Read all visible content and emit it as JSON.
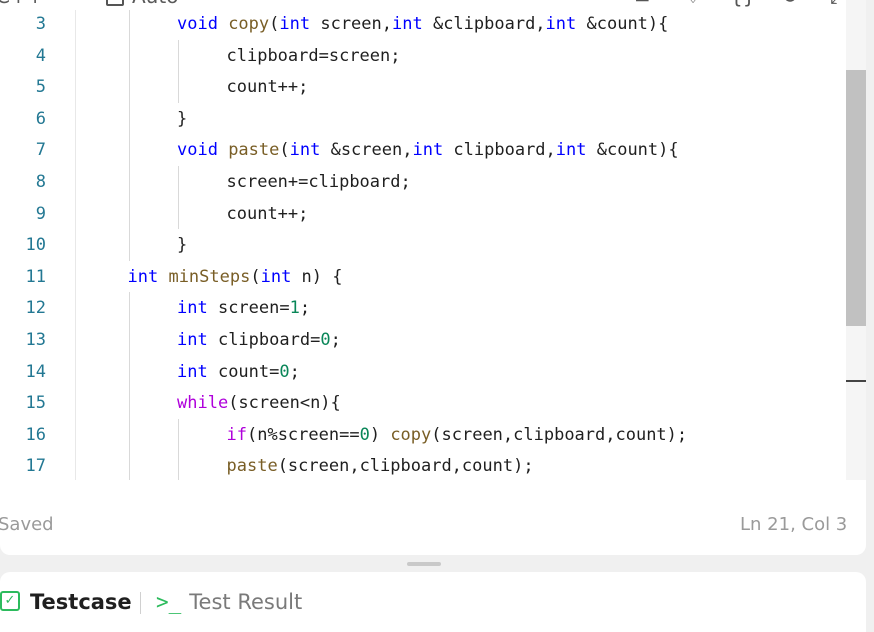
{
  "toolbar": {
    "language": "C++",
    "mode": "Auto",
    "icons": [
      "align-left-icon",
      "bookmark-icon",
      "braces-icon",
      "reset-icon",
      "expand-icon"
    ]
  },
  "editor": {
    "lines": [
      {
        "num": "3",
        "indent": 2,
        "tokens": [
          {
            "t": "void",
            "c": "kw"
          },
          {
            "t": " copy",
            "c": "fn"
          },
          {
            "t": "(",
            "c": "p"
          },
          {
            "t": "int",
            "c": "kw"
          },
          {
            "t": " screen,",
            "c": "p"
          },
          {
            "t": "int",
            "c": "kw"
          },
          {
            "t": " &clipboard,",
            "c": "p"
          },
          {
            "t": "int",
            "c": "kw"
          },
          {
            "t": " &count){",
            "c": "p"
          }
        ]
      },
      {
        "num": "4",
        "indent": 3,
        "tokens": [
          {
            "t": "clipboard=screen;",
            "c": "p"
          }
        ]
      },
      {
        "num": "5",
        "indent": 3,
        "tokens": [
          {
            "t": "count++;",
            "c": "p"
          }
        ]
      },
      {
        "num": "6",
        "indent": 2,
        "tokens": [
          {
            "t": "}",
            "c": "p"
          }
        ]
      },
      {
        "num": "7",
        "indent": 2,
        "tokens": [
          {
            "t": "void",
            "c": "kw"
          },
          {
            "t": " paste",
            "c": "fn"
          },
          {
            "t": "(",
            "c": "p"
          },
          {
            "t": "int",
            "c": "kw"
          },
          {
            "t": " &screen,",
            "c": "p"
          },
          {
            "t": "int",
            "c": "kw"
          },
          {
            "t": " clipboard,",
            "c": "p"
          },
          {
            "t": "int",
            "c": "kw"
          },
          {
            "t": " &count){",
            "c": "p"
          }
        ]
      },
      {
        "num": "8",
        "indent": 3,
        "tokens": [
          {
            "t": "screen+=clipboard;",
            "c": "p"
          }
        ]
      },
      {
        "num": "9",
        "indent": 3,
        "tokens": [
          {
            "t": "count++;",
            "c": "p"
          }
        ]
      },
      {
        "num": "10",
        "indent": 2,
        "tokens": [
          {
            "t": "}",
            "c": "p"
          }
        ]
      },
      {
        "num": "11",
        "indent": 1,
        "tokens": [
          {
            "t": "int",
            "c": "kw"
          },
          {
            "t": " minSteps",
            "c": "fn"
          },
          {
            "t": "(",
            "c": "p"
          },
          {
            "t": "int",
            "c": "kw"
          },
          {
            "t": " n) {",
            "c": "p"
          }
        ]
      },
      {
        "num": "12",
        "indent": 2,
        "tokens": [
          {
            "t": "int",
            "c": "kw"
          },
          {
            "t": " screen=",
            "c": "p"
          },
          {
            "t": "1",
            "c": "num"
          },
          {
            "t": ";",
            "c": "p"
          }
        ]
      },
      {
        "num": "13",
        "indent": 2,
        "tokens": [
          {
            "t": "int",
            "c": "kw"
          },
          {
            "t": " clipboard=",
            "c": "p"
          },
          {
            "t": "0",
            "c": "num"
          },
          {
            "t": ";",
            "c": "p"
          }
        ]
      },
      {
        "num": "14",
        "indent": 2,
        "tokens": [
          {
            "t": "int",
            "c": "kw"
          },
          {
            "t": " count=",
            "c": "p"
          },
          {
            "t": "0",
            "c": "num"
          },
          {
            "t": ";",
            "c": "p"
          }
        ]
      },
      {
        "num": "15",
        "indent": 2,
        "tokens": [
          {
            "t": "while",
            "c": "ctl"
          },
          {
            "t": "(screen<n){",
            "c": "p"
          }
        ]
      },
      {
        "num": "16",
        "indent": 3,
        "tokens": [
          {
            "t": "if",
            "c": "ctl"
          },
          {
            "t": "(n%screen==",
            "c": "p"
          },
          {
            "t": "0",
            "c": "num"
          },
          {
            "t": ") ",
            "c": "p"
          },
          {
            "t": "copy",
            "c": "fn"
          },
          {
            "t": "(screen,clipboard,count);",
            "c": "p"
          }
        ]
      },
      {
        "num": "17",
        "indent": 3,
        "tokens": [
          {
            "t": "paste",
            "c": "fn"
          },
          {
            "t": "(screen,clipboard,count);",
            "c": "p"
          }
        ]
      }
    ]
  },
  "colors": {
    "kw": "#0000ff",
    "fn": "#795e26",
    "p": "#1f1f1f",
    "num": "#098658",
    "ctl": "#af00db"
  },
  "status": {
    "saved": "Saved",
    "cursor": "Ln 21, Col 3"
  },
  "bottom_tabs": {
    "testcase": "Testcase",
    "test_result": "Test Result"
  }
}
